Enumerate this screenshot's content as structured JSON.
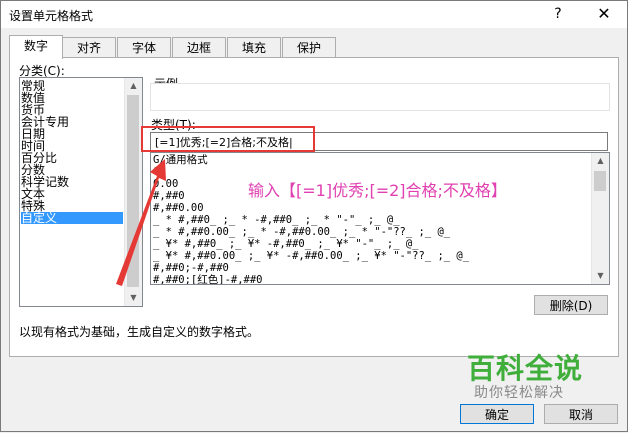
{
  "window": {
    "title": "设置单元格格式",
    "help_icon": "?",
    "close_icon": "✕"
  },
  "tabs": [
    {
      "label": "数字",
      "active": true
    },
    {
      "label": "对齐"
    },
    {
      "label": "字体"
    },
    {
      "label": "边框"
    },
    {
      "label": "填充"
    },
    {
      "label": "保护"
    }
  ],
  "category": {
    "label": "分类(C):",
    "items": [
      "常规",
      "数值",
      "货币",
      "会计专用",
      "日期",
      "时间",
      "百分比",
      "分数",
      "科学记数",
      "文本",
      "特殊",
      "自定义"
    ],
    "selected_index": 11
  },
  "sample": {
    "label": "示例"
  },
  "type_field": {
    "label": "类型(T):",
    "value": "[=1]优秀;[=2]合格;不及格|"
  },
  "format_list": [
    "G/通用格式",
    "0",
    "0.00",
    "#,##0",
    "#,##0.00",
    "_ * #,##0_ ;_ * -#,##0_ ;_ * \"-\"_ ;_ @_",
    "_ * #,##0.00_ ;_ * -#,##0.00_ ;_ * \"-\"??_ ;_ @_",
    "_ ¥* #,##0_ ;_ ¥* -#,##0_ ;_ ¥* \"-\"_ ;_ @_",
    "_ ¥* #,##0.00_ ;_ ¥* -#,##0.00_ ;_ ¥* \"-\"??_ ;_ @_",
    "#,##0;-#,##0",
    "#,##0;[红色]-#,##0"
  ],
  "annotation": "输入【[=1]优秀;[=2]合格;不及格】",
  "delete_button": "删除(D)",
  "description": "以现有格式为基础，生成自定义的数字格式。",
  "ok_button": "确定",
  "cancel_button": "取消",
  "watermark": {
    "title": "百科全说",
    "subtitle": "助你轻松解决"
  },
  "colors": {
    "annotation": "#e040b0",
    "highlight": "#e53935",
    "selection": "#3399ff",
    "watermark": "#3fae3a"
  }
}
